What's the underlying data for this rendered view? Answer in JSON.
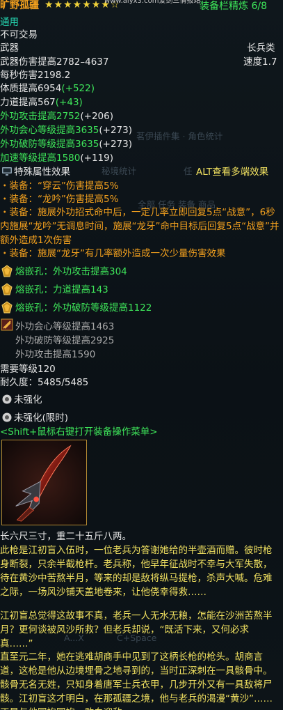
{
  "header": {
    "item_name": "旷野孤疆",
    "stars_filled": 7,
    "stars_total": 8,
    "stars_text": "★★★★★★★☆",
    "watermark_url": "www.aiyx3.com爱剑三情报站",
    "equip_score_label": "装备栏精炼 6/8"
  },
  "type_line": "通用",
  "trade_line": "不可交易",
  "slot": {
    "left": "武器",
    "right": "长兵类"
  },
  "damage": {
    "text": "武器伤害提高2782–4637",
    "speed": "速度1.7"
  },
  "dps": "每秒伤害2198.2",
  "base_attrs": [
    {
      "base": "体质提高6954",
      "bonus": "(+522)"
    },
    {
      "base": "力道提高567",
      "bonus": "(+43)"
    }
  ],
  "green_attrs": [
    {
      "base": "外功攻击提高2752",
      "bonus": "(+206)"
    },
    {
      "base": "外功会心等级提高3635",
      "bonus": "(+273)"
    },
    {
      "base": "外功破防等级提高3635",
      "bonus": "(+273)"
    },
    {
      "base": "加速等级提高1580",
      "bonus": "(+119)"
    }
  ],
  "special": {
    "title": "特殊属性效果",
    "alt_hint": "ALT查看多端效果"
  },
  "effects": [
    "・装备：“穿云”伤害提高5%",
    "・装备：“龙吟”伤害提高5%",
    "・装备：施展外功招式命中后，一定几率立即回复5点“战意”，6秒内施展“龙吟”无调息时间，施展“龙牙”命中目标后回复5点“战意”并额外造成1次伤害",
    "・装备：施展“龙牙”有几率额外造成一次少量伤害效果"
  ],
  "gems": [
    "熔嵌孔：外功攻击提高304",
    "熔嵌孔：力道提高143",
    "熔嵌孔：外功破防等级提高1122"
  ],
  "enchant": [
    "外功会心等级提高1463",
    "外功破防等级提高2925",
    "外功攻击提高1590"
  ],
  "require_level": "需要等级120",
  "durability": "耐久度：5485/5485",
  "strengthen": [
    "未强化",
    "未强化(限时)"
  ],
  "shift_hint": "<Shift+鼠标右键打开装备操作菜单>",
  "lore_title": "长六尺三寸，重二十五斤八两。",
  "lore": [
    "此枪是江初盲入伍时，一位老兵为答谢她给的半壶酒而赠。彼时枪身断裂，只余半截枪杆。老兵称，他早年征战时不幸与大军失散，待在黄沙中苦熬半月，等来的却是敌将纵马提枪，杀声大喊。危难之际，一场风沙铺天盖地卷来，让他侥幸得救……",
    "江初盲总觉得这故事不真，老兵一人无水无粮，怎能在沙洲苦熬半月？更何谈被风沙所救？但老兵却说，“既活下来，又何必求真……”",
    "直至元二年，她在逃难胡商手中见到了这柄长枪的枪头。胡商言道，这枪是他从边境埋骨之地寻到的，当时正深刺在一具骸骨中。骸骨无名无姓，只知身着唐军士兵衣甲，几步开外又有一具敌将尸骸。江初盲这才明白，在那孤疆之境，他与老兵的渴漫“黄沙”……正是与他同袍同袍，敢血迎敌"
  ],
  "ghost_text": {
    "plugin": "茗伊插件集 · 角色统计",
    "secret": "秘境统计",
    "task": "任",
    "tabs": "全部      任务      装备      商品",
    "hotkey1": "A...X",
    "hotkey2": "C+Space"
  },
  "colors": {
    "green": "#3ee65a",
    "orange": "#f2a01e",
    "yellow": "#f0e060",
    "teal": "#25d5b0",
    "white": "#e6e6e6"
  }
}
